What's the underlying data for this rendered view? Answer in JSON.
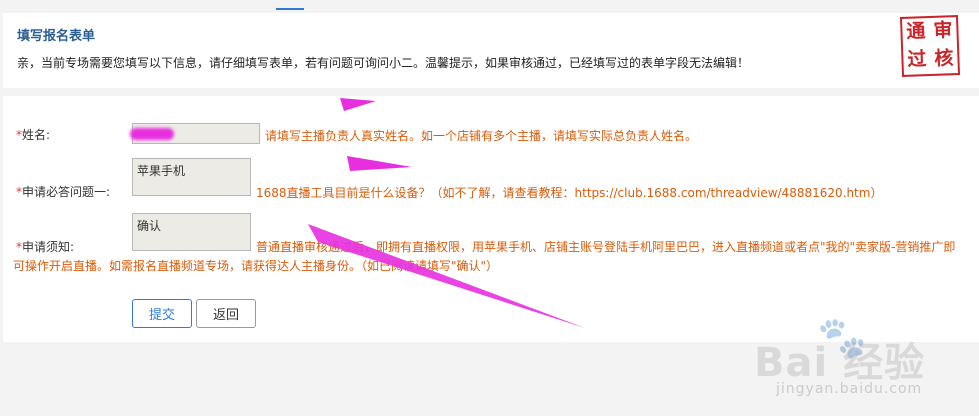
{
  "header": {
    "title": "填写报名表单",
    "description": "亲，当前专场需要您填写以下信息，请仔细填写表单，若有问题可询问小二。温馨提示，如果审核通过，已经填写过的表单字段无法编辑！",
    "stamp": [
      "审",
      "通",
      "过",
      "核"
    ]
  },
  "form": {
    "fields": [
      {
        "required_mark": "*",
        "label": "姓名:",
        "value": "",
        "hint": "请填写主播负责人真实姓名。如一个店铺有多个主播，请填写实际总负责人姓名。"
      },
      {
        "required_mark": "*",
        "label": "申请必答问题一:",
        "value": "苹果手机",
        "hint": "1688直播工具目前是什么设备？（如不了解，请查看教程：https://club.1688.com/threadview/48881620.htm）"
      },
      {
        "required_mark": "*",
        "label": "申请须知:",
        "value": "确认",
        "hint": "普通直播审核通过后，即拥有直播权限，用苹果手机、店铺主账号登陆手机阿里巴巴，进入直播频道或者点\"我的\"卖家版-营销推广即可操作开启直播。如需报名直播频道专场，请获得达人主播身份。（如已阅读请填写\"确认\"）"
      }
    ],
    "submit_label": "提交",
    "back_label": "返回"
  },
  "watermark": {
    "brand": "Bai  经验",
    "url": "jingyan.baidu.com"
  },
  "colors": {
    "title": "#2b5f93",
    "hint": "#d85c0b",
    "required": "#e03b3b",
    "primary": "#2f7ad6",
    "annotation_arrow": "#e82fe0",
    "stamp": "#c8262a"
  }
}
